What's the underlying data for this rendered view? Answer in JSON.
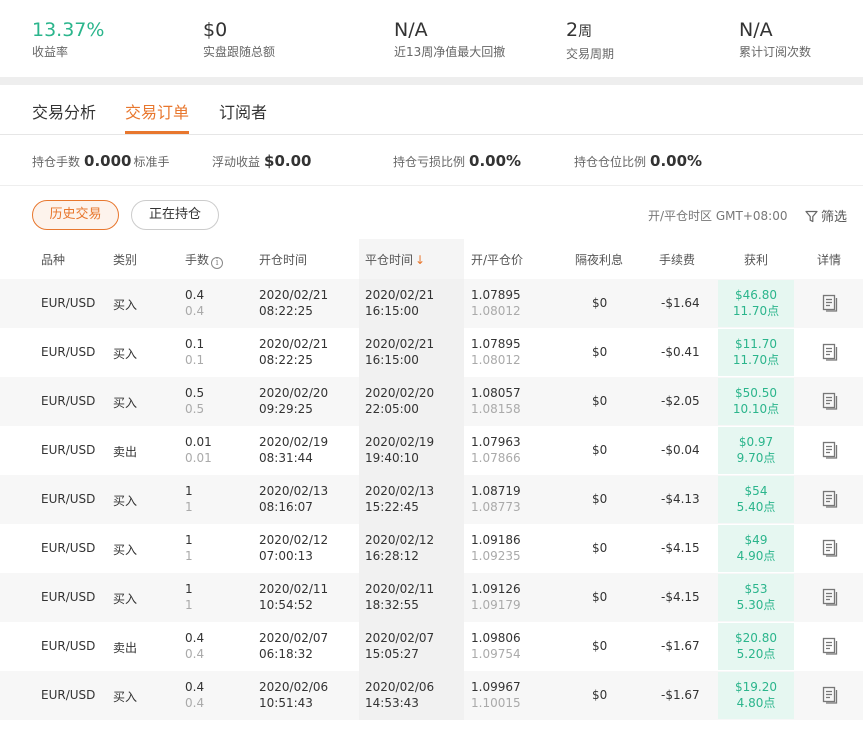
{
  "stats": [
    {
      "value": "13.37%",
      "unit": "",
      "label": "收益率",
      "green": true
    },
    {
      "value": "$0",
      "unit": "",
      "label": "实盘跟随总额",
      "green": false
    },
    {
      "value": "N/A",
      "unit": "",
      "label": "近13周净值最大回撤",
      "green": false
    },
    {
      "value": "2",
      "unit": "周",
      "label": "交易周期",
      "green": false
    },
    {
      "value": "N/A",
      "unit": "",
      "label": "累计订阅次数",
      "green": false
    }
  ],
  "tabs": [
    "交易分析",
    "交易订单",
    "订阅者"
  ],
  "active_tab": 1,
  "summary": {
    "positions_label": "持仓手数",
    "positions_value": "0.000",
    "positions_unit": "标准手",
    "floating_label": "浮动收益",
    "floating_value": "$0.00",
    "loss_ratio_label": "持仓亏损比例",
    "loss_ratio_value": "0.00%",
    "margin_ratio_label": "持仓仓位比例",
    "margin_ratio_value": "0.00%"
  },
  "filters": {
    "history_label": "历史交易",
    "open_label": "正在持仓",
    "timezone": "开/平仓时区 GMT+08:00",
    "filter_label": "筛选"
  },
  "columns": {
    "symbol": "品种",
    "type": "类别",
    "lots": "手数",
    "open_time": "开仓时间",
    "close_time": "平仓时间",
    "price": "开/平仓价",
    "swap": "隔夜利息",
    "fee": "手续费",
    "profit": "获利",
    "detail": "详情",
    "info_icon": "i",
    "sort_arrow": "↓"
  },
  "rows": [
    {
      "symbol": "EUR/USD",
      "type": "买入",
      "lots": "0.4",
      "lots_sub": "0.4",
      "open_date": "2020/02/21",
      "open_time": "08:22:25",
      "close_date": "2020/02/21",
      "close_time": "16:15:00",
      "open_price": "1.07895",
      "close_price": "1.08012",
      "swap": "$0",
      "fee": "-$1.64",
      "profit": "$46.80",
      "points": "11.70点"
    },
    {
      "symbol": "EUR/USD",
      "type": "买入",
      "lots": "0.1",
      "lots_sub": "0.1",
      "open_date": "2020/02/21",
      "open_time": "08:22:25",
      "close_date": "2020/02/21",
      "close_time": "16:15:00",
      "open_price": "1.07895",
      "close_price": "1.08012",
      "swap": "$0",
      "fee": "-$0.41",
      "profit": "$11.70",
      "points": "11.70点"
    },
    {
      "symbol": "EUR/USD",
      "type": "买入",
      "lots": "0.5",
      "lots_sub": "0.5",
      "open_date": "2020/02/20",
      "open_time": "09:29:25",
      "close_date": "2020/02/20",
      "close_time": "22:05:00",
      "open_price": "1.08057",
      "close_price": "1.08158",
      "swap": "$0",
      "fee": "-$2.05",
      "profit": "$50.50",
      "points": "10.10点"
    },
    {
      "symbol": "EUR/USD",
      "type": "卖出",
      "lots": "0.01",
      "lots_sub": "0.01",
      "open_date": "2020/02/19",
      "open_time": "08:31:44",
      "close_date": "2020/02/19",
      "close_time": "19:40:10",
      "open_price": "1.07963",
      "close_price": "1.07866",
      "swap": "$0",
      "fee": "-$0.04",
      "profit": "$0.97",
      "points": "9.70点"
    },
    {
      "symbol": "EUR/USD",
      "type": "买入",
      "lots": "1",
      "lots_sub": "1",
      "open_date": "2020/02/13",
      "open_time": "08:16:07",
      "close_date": "2020/02/13",
      "close_time": "15:22:45",
      "open_price": "1.08719",
      "close_price": "1.08773",
      "swap": "$0",
      "fee": "-$4.13",
      "profit": "$54",
      "points": "5.40点"
    },
    {
      "symbol": "EUR/USD",
      "type": "买入",
      "lots": "1",
      "lots_sub": "1",
      "open_date": "2020/02/12",
      "open_time": "07:00:13",
      "close_date": "2020/02/12",
      "close_time": "16:28:12",
      "open_price": "1.09186",
      "close_price": "1.09235",
      "swap": "$0",
      "fee": "-$4.15",
      "profit": "$49",
      "points": "4.90点"
    },
    {
      "symbol": "EUR/USD",
      "type": "买入",
      "lots": "1",
      "lots_sub": "1",
      "open_date": "2020/02/11",
      "open_time": "10:54:52",
      "close_date": "2020/02/11",
      "close_time": "18:32:55",
      "open_price": "1.09126",
      "close_price": "1.09179",
      "swap": "$0",
      "fee": "-$4.15",
      "profit": "$53",
      "points": "5.30点"
    },
    {
      "symbol": "EUR/USD",
      "type": "卖出",
      "lots": "0.4",
      "lots_sub": "0.4",
      "open_date": "2020/02/07",
      "open_time": "06:18:32",
      "close_date": "2020/02/07",
      "close_time": "15:05:27",
      "open_price": "1.09806",
      "close_price": "1.09754",
      "swap": "$0",
      "fee": "-$1.67",
      "profit": "$20.80",
      "points": "5.20点"
    },
    {
      "symbol": "EUR/USD",
      "type": "买入",
      "lots": "0.4",
      "lots_sub": "0.4",
      "open_date": "2020/02/06",
      "open_time": "10:51:43",
      "close_date": "2020/02/06",
      "close_time": "14:53:43",
      "open_price": "1.09967",
      "close_price": "1.10015",
      "swap": "$0",
      "fee": "-$1.67",
      "profit": "$19.20",
      "points": "4.80点"
    }
  ],
  "colors": {
    "accent": "#e8772e",
    "profit": "#2bb58c",
    "profit_bg": "#e6f7f1"
  },
  "icons": {
    "detail": "document-icon",
    "filter": "filter-icon",
    "info": "info-icon"
  }
}
